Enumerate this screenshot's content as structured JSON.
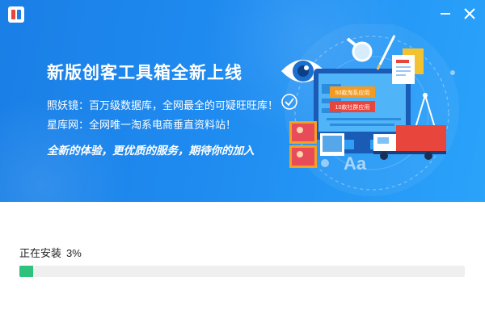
{
  "window": {
    "icon": "app-logo-icon",
    "controls": {
      "minimize_icon": "minimize-icon",
      "close_icon": "close-icon"
    }
  },
  "banner": {
    "title": "新版创客工具箱全新上线",
    "lines": [
      "照妖镜：百万级数据库，全网最全的可疑旺旺库！",
      "星库网：全网唯一淘系电商垂直资料站！"
    ],
    "slogan": "全新的体验，更优质的服务，期待你的加入",
    "illustration": {
      "screen_labels": [
        "50款淘系应用",
        "10款社群应用"
      ],
      "text_glyph": "Aa",
      "icons": [
        "eye-icon",
        "magnifier-icon",
        "pen-icon",
        "document-icon",
        "photos-icon",
        "truck-icon",
        "monitor-icon",
        "checkmark-icon"
      ]
    }
  },
  "install": {
    "status_label": "正在安装",
    "percent_text": "3%",
    "progress": 0.03
  },
  "colors": {
    "banner_start": "#1a7fe6",
    "banner_end": "#2aa3fb",
    "progress_fill": "#2ec27e",
    "progress_track": "#efefef"
  }
}
